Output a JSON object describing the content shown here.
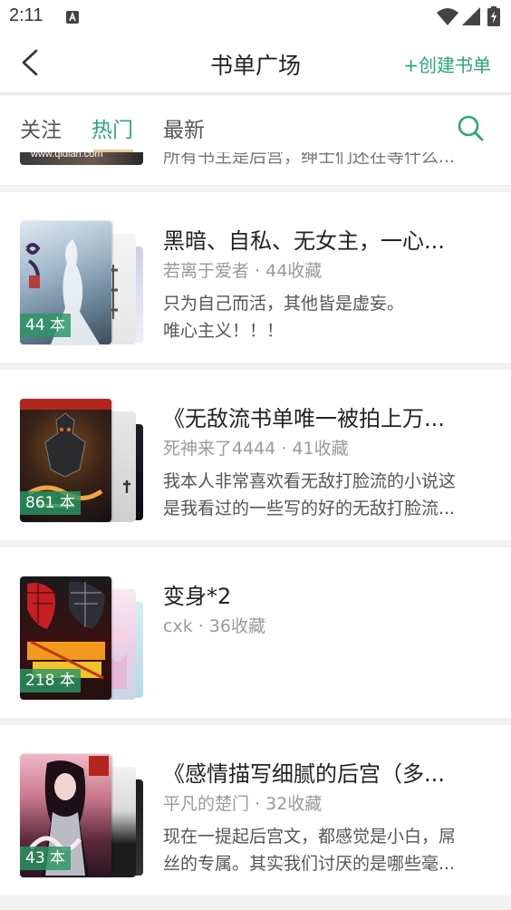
{
  "status_bar": {
    "time": "2:11",
    "icons": [
      "sim-card-icon",
      "wifi-icon",
      "cell-signal-icon",
      "battery-charging-icon"
    ]
  },
  "header": {
    "title": "书单广场",
    "create_label": "+创建书单",
    "back_icon": "chevron-left-icon"
  },
  "tabs": [
    {
      "label": "关注",
      "active": false
    },
    {
      "label": "热门",
      "active": true
    },
    {
      "label": "最新",
      "active": false
    }
  ],
  "search_icon": "search-icon",
  "colors": {
    "accent": "#2aa67a",
    "tab_indicator": "#e9c99a",
    "badge_bg": "#2a9664",
    "meta_text": "#9a9a9a",
    "background": "#f1f1f1"
  },
  "peek_item": {
    "thumb_text": "www.qidian.com",
    "description": "所有书主是后宫，绅士们还在等什么..."
  },
  "booklists": [
    {
      "title": "黑暗、自私、无女主，一心...",
      "meta": "若离于爱者 · 44收藏",
      "count_badge": "44 本",
      "desc_lines": [
        "只为自己而活，其他皆是虚妄。",
        "唯心主义！！！"
      ]
    },
    {
      "title": "《无敌流书单唯一被拍上万...",
      "meta": "死神来了4444 · 41收藏",
      "count_badge": "861 本",
      "desc_lines": [
        "我本人非常喜欢看无敌打脸流的小说这",
        "是我看过的一些写的好的无敌打脸流..."
      ]
    },
    {
      "title": "变身*2",
      "meta": "cxk · 36收藏",
      "count_badge": "218 本",
      "desc_lines": []
    },
    {
      "title": "《感情描写细腻的后宫（多...",
      "meta": "平凡的楚门 · 32收藏",
      "count_badge": "43 本",
      "desc_lines": [
        "现在一提起后宫文，都感觉是小白，屌",
        "丝的专属。其实我们讨厌的是哪些毫..."
      ]
    }
  ]
}
